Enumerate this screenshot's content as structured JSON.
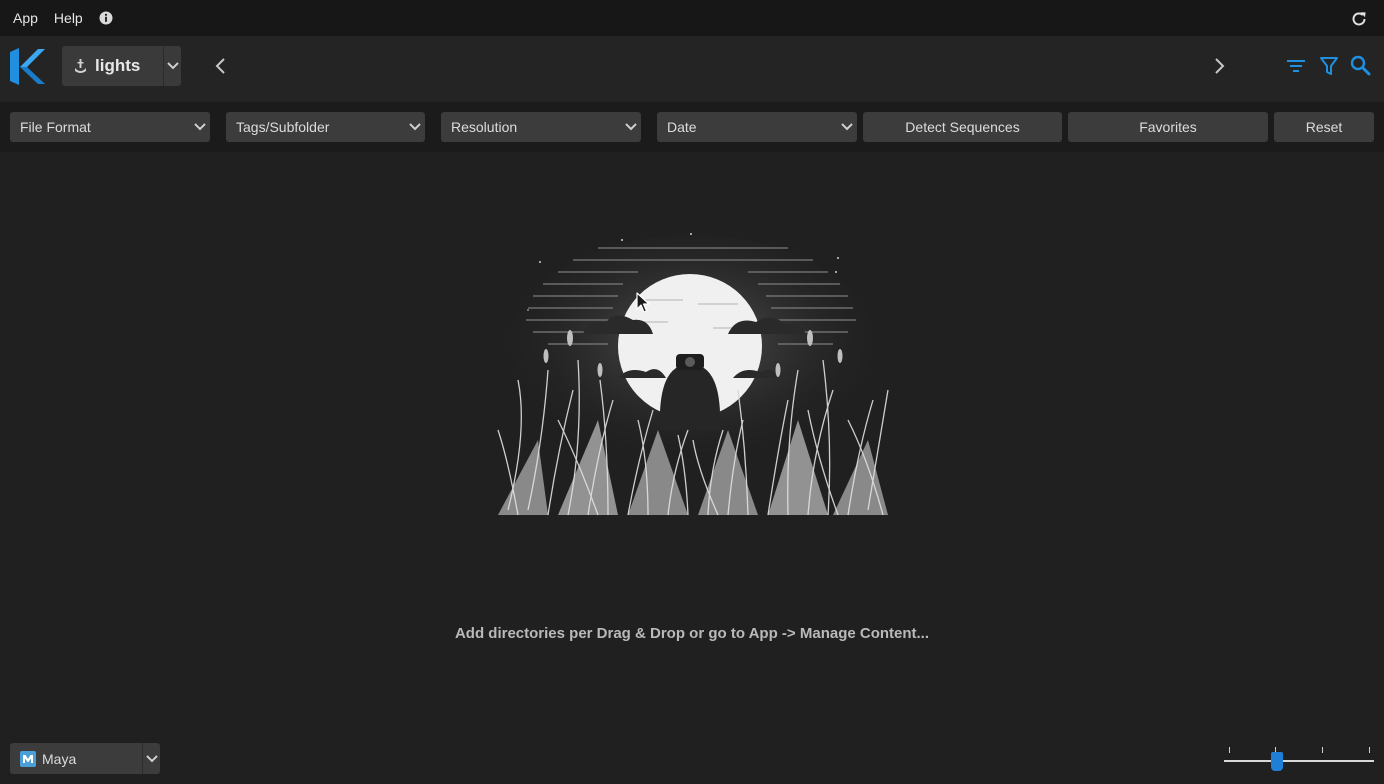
{
  "menu": {
    "app": "App",
    "help": "Help"
  },
  "icons": {
    "info": "info-icon",
    "refresh": "refresh-icon",
    "logo": "k-logo",
    "library": "anchor-icon",
    "prev": "chevron-left-icon",
    "next": "chevron-right-icon",
    "sort": "sort-icon",
    "filter": "filter-icon",
    "search": "search-icon",
    "maya": "maya-icon"
  },
  "toolbar": {
    "library_selected": "lights"
  },
  "filters": {
    "file_format": "File Format",
    "tags_subfolder": "Tags/Subfolder",
    "resolution": "Resolution",
    "date": "Date",
    "detect_sequences": "Detect Sequences",
    "favorites": "Favorites",
    "reset": "Reset"
  },
  "main": {
    "empty_message": "Add directories per Drag & Drop or go to App -> Manage Content..."
  },
  "footer": {
    "app_selected": "Maya",
    "zoom_level": 0.35
  },
  "colors": {
    "accent": "#1f8fe0",
    "background": "#202020",
    "panel": "#3c3c3c"
  }
}
